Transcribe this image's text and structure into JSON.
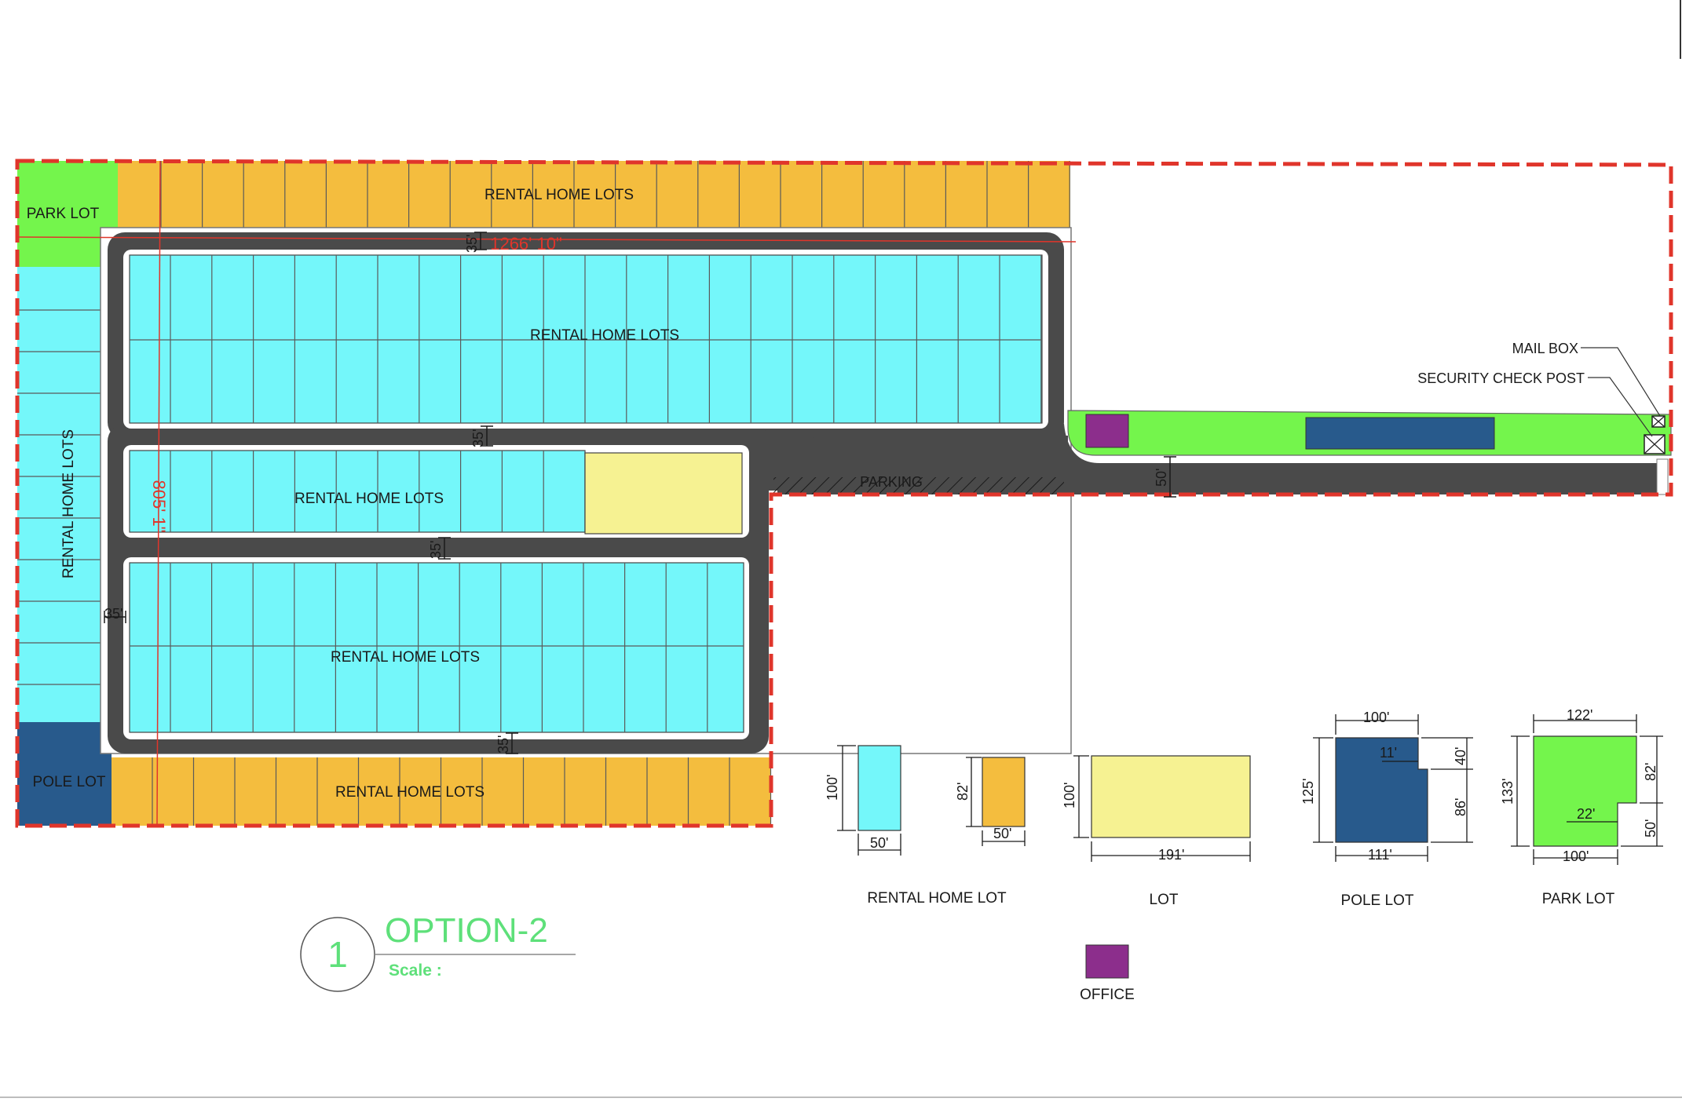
{
  "site": {
    "labels": {
      "park_lot": "PARK LOT",
      "pole_lot": "POLE LOT",
      "rental_top": "RENTAL HOME LOTS",
      "rental_block1": "RENTAL HOME LOTS",
      "rental_block2": "RENTAL HOME LOTS",
      "rental_block3": "RENTAL HOME LOTS",
      "rental_left": "RENTAL HOME LOTS",
      "rental_bottom": "RENTAL HOME LOTS",
      "parking": "PARKING",
      "mail_box": "MAIL BOX",
      "security_check_post": "SECURITY CHECK POST"
    },
    "road_dims": {
      "top": "35'",
      "mid1": "35'",
      "mid2": "35'",
      "bottom": "35'",
      "left": "35'",
      "entry": "50'"
    },
    "red_dims": {
      "horizontal": "1266' 10\"",
      "vertical": "805' 1\""
    },
    "colors": {
      "boundary": "#e0352b",
      "road": "#4a4a4a",
      "rental_cyan": "#74f7fa",
      "rental_orange": "#f4bd3e",
      "park_green": "#74f54c",
      "pole_navy": "#285a8c",
      "lot_yellow": "#f6f292",
      "office_purple": "#8c2e8c"
    }
  },
  "legend": {
    "rental_home_lot": {
      "label": "RENTAL HOME LOT",
      "w1": "100'",
      "w2": "50'",
      "o1": "82'",
      "o2": "50'"
    },
    "lot": {
      "label": "LOT",
      "h": "100'",
      "w": "191'"
    },
    "pole_lot": {
      "label": "POLE LOT",
      "top": "100'",
      "notch_w": "11'",
      "notch_h": "40'",
      "left": "125'",
      "right": "86'",
      "bottom": "111'"
    },
    "park_lot": {
      "label": "PARK LOT",
      "top": "122'",
      "right_top": "82'",
      "notch_w": "22'",
      "notch_h": "50'",
      "left": "133'",
      "bottom": "100'"
    },
    "office": {
      "label": "OFFICE"
    }
  },
  "title_block": {
    "number": "1",
    "option": "OPTION-2",
    "scale": "Scale :"
  }
}
